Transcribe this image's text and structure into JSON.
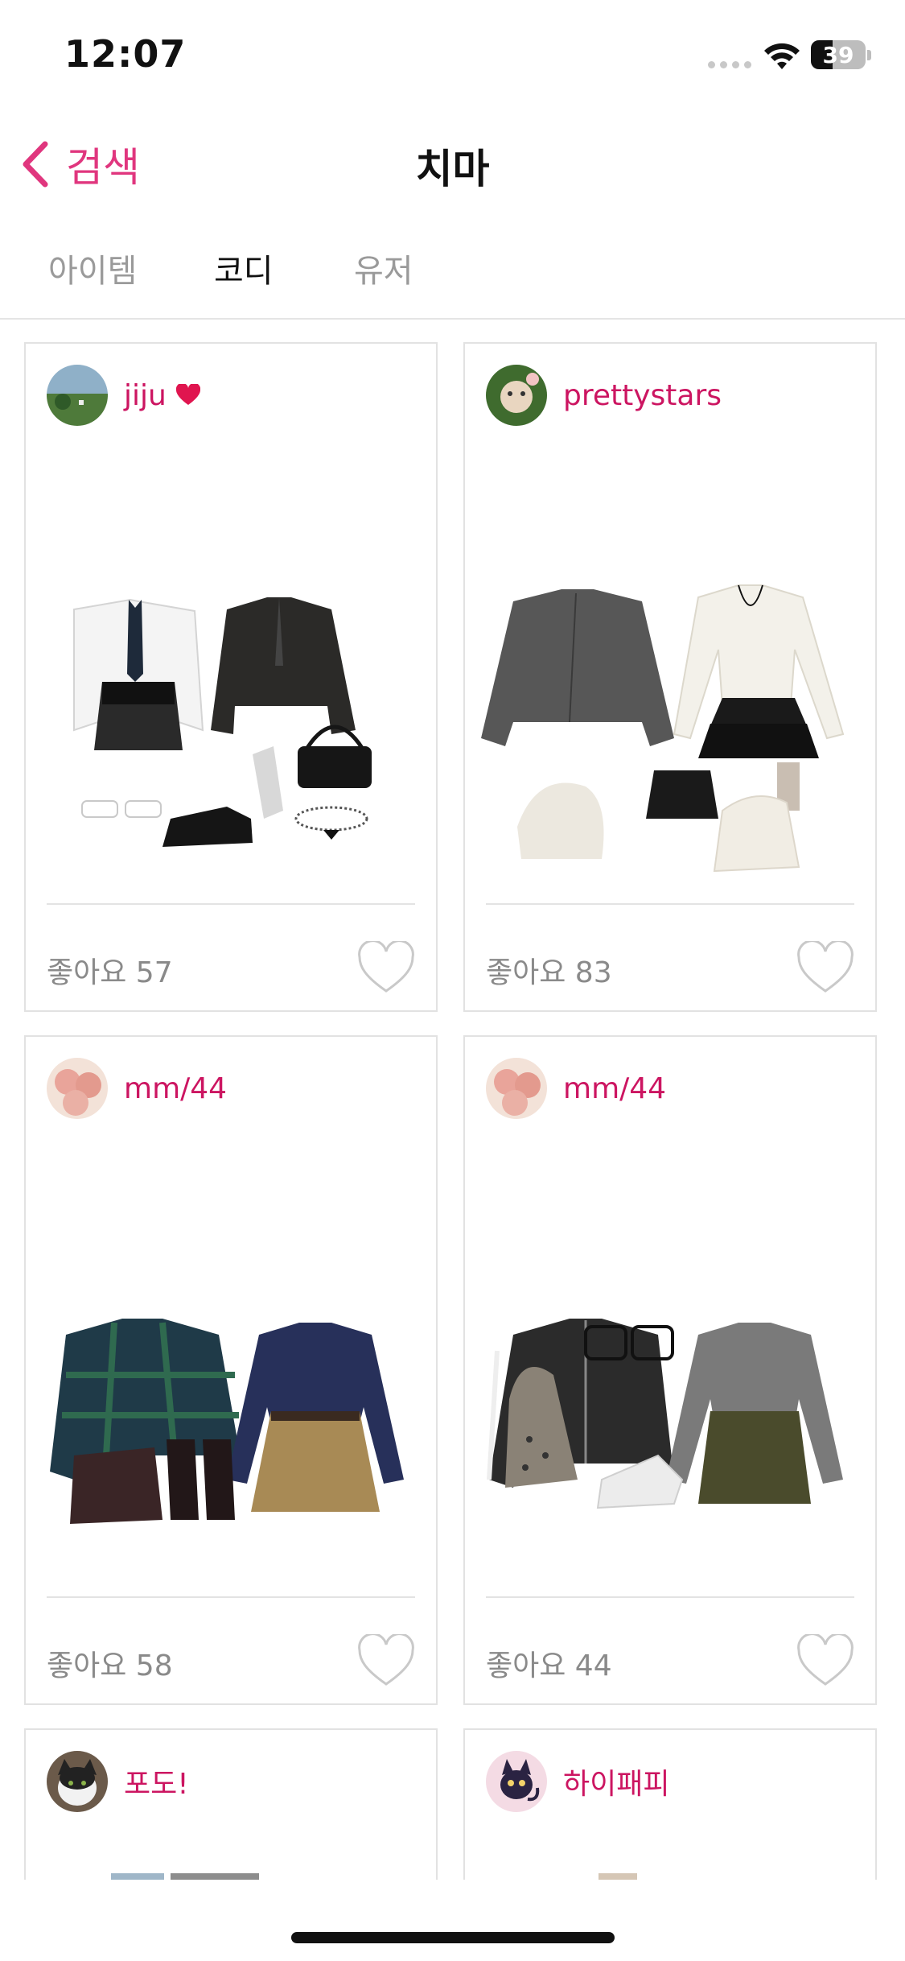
{
  "status": {
    "time": "12:07",
    "battery": "39",
    "battery_level": 0.39
  },
  "nav": {
    "back_label": "검색",
    "title": "치마"
  },
  "tabs": [
    {
      "label": "아이템",
      "active": false
    },
    {
      "label": "코디",
      "active": true
    },
    {
      "label": "유저",
      "active": false
    }
  ],
  "cards": [
    {
      "username": "jiju",
      "has_heart_badge": true,
      "likes_text": "좋아요 57",
      "avatar": "landscape-avatar",
      "outfit": "white shirt, tie, black skirt, blazer, loafers, bag"
    },
    {
      "username": "prettystars",
      "has_heart_badge": false,
      "likes_text": "좋아요 83",
      "avatar": "cat-avatar",
      "outfit": "grey coat, white knit, ruffle skirt, beanie, boots"
    },
    {
      "username": "mm/44",
      "has_heart_badge": false,
      "likes_text": "좋아요 58",
      "avatar": "peach-avatar",
      "outfit": "plaid jacket, navy sweater, pleated skirt, loafers"
    },
    {
      "username": "mm/44",
      "has_heart_badge": false,
      "likes_text": "좋아요 44",
      "avatar": "peach-avatar",
      "outfit": "leather jacket, grey knit, cargo skirt, sneakers"
    },
    {
      "username": "포도!",
      "has_heart_badge": false,
      "likes_text": "",
      "avatar": "cat-avatar",
      "outfit": ""
    },
    {
      "username": "하이패피",
      "has_heart_badge": false,
      "likes_text": "",
      "avatar": "cartoon-cat-avatar",
      "outfit": ""
    }
  ],
  "colors": {
    "accent": "#e0367e",
    "username": "#cc1561",
    "muted": "#8a8a8a"
  }
}
